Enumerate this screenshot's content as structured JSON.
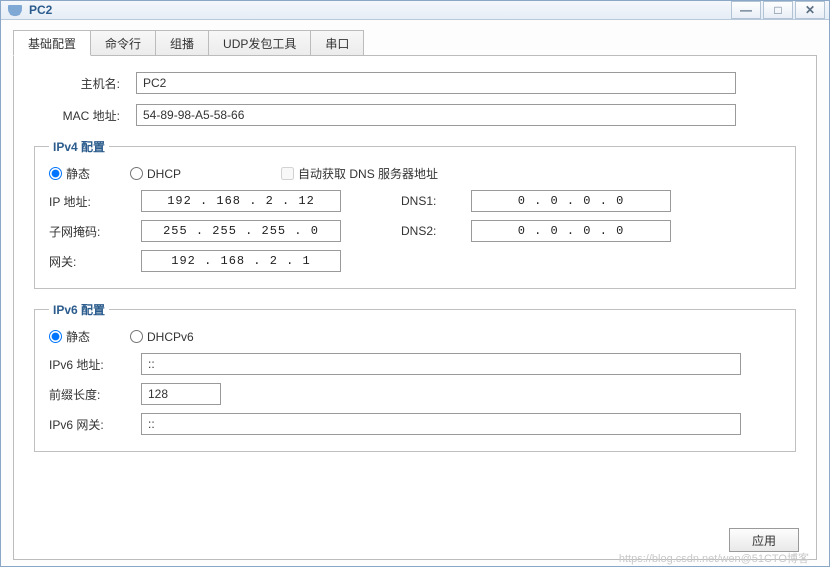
{
  "titlebar": {
    "title": "PC2"
  },
  "tabs": [
    {
      "label": "基础配置",
      "active": true
    },
    {
      "label": "命令行",
      "active": false
    },
    {
      "label": "组播",
      "active": false
    },
    {
      "label": "UDP发包工具",
      "active": false
    },
    {
      "label": "串口",
      "active": false
    }
  ],
  "basic": {
    "hostname_label": "主机名:",
    "hostname_value": "PC2",
    "mac_label": "MAC 地址:",
    "mac_value": "54-89-98-A5-58-66"
  },
  "ipv4": {
    "legend": "IPv4 配置",
    "radio_static": "静态",
    "radio_dhcp": "DHCP",
    "auto_dns_label": "自动获取 DNS 服务器地址",
    "mode": "static",
    "auto_dns_checked": false,
    "ip_label": "IP 地址:",
    "ip_value": "192  . 168  .  2   .  12",
    "mask_label": "子网掩码:",
    "mask_value": "255  . 255  . 255  .  0",
    "gw_label": "网关:",
    "gw_value": "192  . 168  .  2   .  1",
    "dns1_label": "DNS1:",
    "dns1_value": "0   .  0   .  0   .  0",
    "dns2_label": "DNS2:",
    "dns2_value": "0   .  0   .  0   .  0"
  },
  "ipv6": {
    "legend": "IPv6 配置",
    "radio_static": "静态",
    "radio_dhcp": "DHCPv6",
    "mode": "static",
    "addr_label": "IPv6 地址:",
    "addr_value": "::",
    "prefix_label": "前缀长度:",
    "prefix_value": "128",
    "gw_label": "IPv6 网关:",
    "gw_value": "::"
  },
  "buttons": {
    "apply": "应用"
  },
  "watermark": "https://blog.csdn.net/wen@51CTO博客"
}
